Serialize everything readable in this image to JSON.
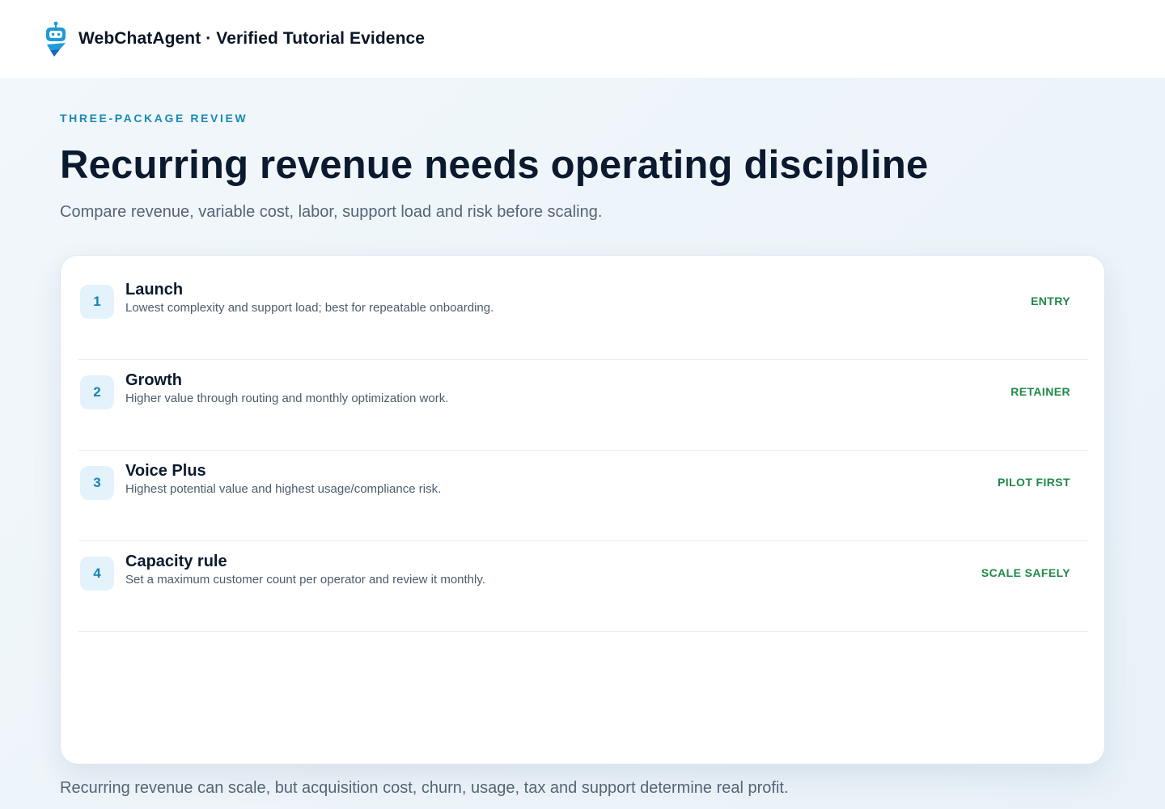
{
  "header": {
    "brand_title": "WebChatAgent · Verified Tutorial Evidence",
    "logo_icon": "robot-icon",
    "logo_colors": {
      "primary": "#1e9bd7",
      "secondary": "#1565c0"
    }
  },
  "hero": {
    "eyebrow": "THREE-PACKAGE REVIEW",
    "headline": "Recurring revenue needs operating discipline",
    "subtitle": "Compare revenue, variable cost, labor, support load and risk before scaling."
  },
  "packages": [
    {
      "number": "1",
      "title": "Launch",
      "description": "Lowest complexity and support load; best for repeatable onboarding.",
      "tag": "ENTRY"
    },
    {
      "number": "2",
      "title": "Growth",
      "description": "Higher value through routing and monthly optimization work.",
      "tag": "RETAINER"
    },
    {
      "number": "3",
      "title": "Voice Plus",
      "description": "Highest potential value and highest usage/compliance risk.",
      "tag": "PILOT FIRST"
    },
    {
      "number": "4",
      "title": "Capacity rule",
      "description": "Set a maximum customer count per operator and review it monthly.",
      "tag": "SCALE SAFELY"
    }
  ],
  "footer": {
    "note": "Recurring revenue can scale, but acquisition cost, churn, usage, tax and support determine real profit."
  },
  "colors": {
    "accent": "#1a8ab5",
    "tag_green": "#1f8a47",
    "heading": "#0b1a2e"
  }
}
